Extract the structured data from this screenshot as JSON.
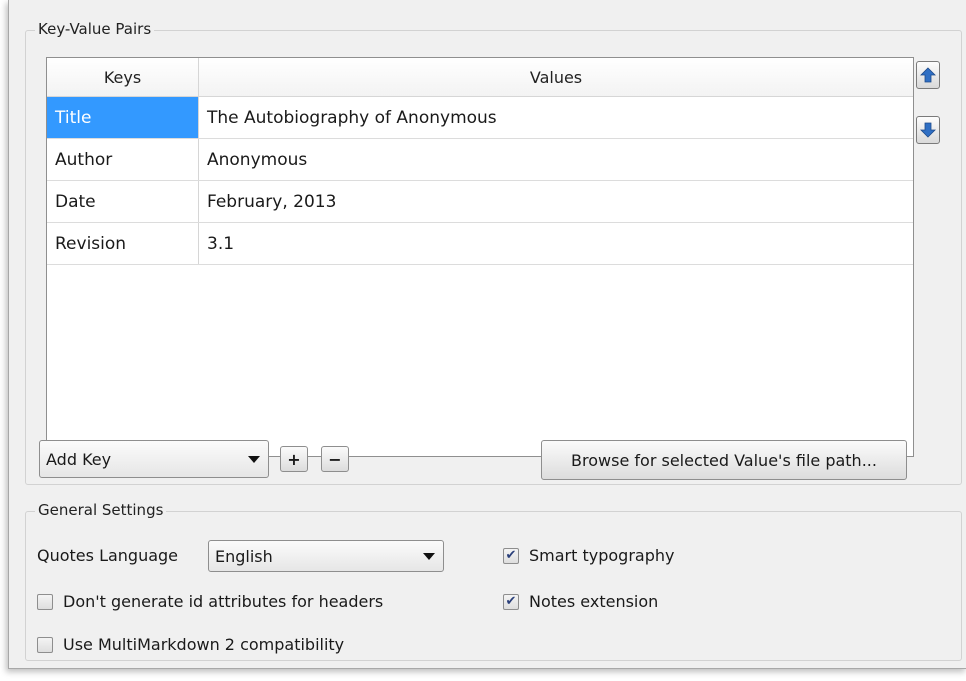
{
  "kv_group": {
    "title": "Key-Value Pairs",
    "table": {
      "columns": [
        "Keys",
        "Values"
      ],
      "rows": [
        {
          "key": "Title",
          "value": "The Autobiography of Anonymous"
        },
        {
          "key": "Author",
          "value": "Anonymous"
        },
        {
          "key": "Date",
          "value": "February, 2013"
        },
        {
          "key": "Revision",
          "value": "3.1"
        }
      ],
      "selected_row": 0
    },
    "add_key_combo": "Add Key",
    "add_button": "+",
    "remove_button": "−",
    "browse_button": "Browse for selected Value's file path..."
  },
  "general_group": {
    "title": "General Settings",
    "quotes_language_label": "Quotes Language",
    "quotes_language_value": "English",
    "smart_typography": {
      "label": "Smart typography",
      "checked": true
    },
    "no_id_attributes": {
      "label": "Don't generate id attributes for headers",
      "checked": false
    },
    "notes_extension": {
      "label": "Notes extension",
      "checked": true
    },
    "multimarkdown": {
      "label": "Use MultiMarkdown 2 compatibility",
      "checked": false
    }
  },
  "icons": {
    "move_up": "arrow-up-icon",
    "move_down": "arrow-down-icon",
    "accent": "#3399ff",
    "arrow_color": "#2f6fc4"
  }
}
